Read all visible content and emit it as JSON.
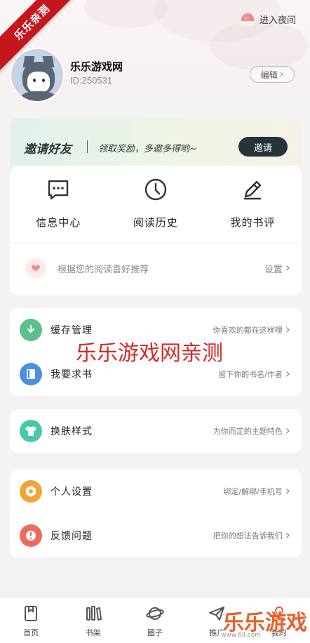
{
  "watermark": {
    "ribbon": "乐乐亲测",
    "center": "乐乐游戏网亲测",
    "bottom": "乐乐游戏",
    "url": "www.6ll.com"
  },
  "header": {
    "night_mode_label": "进入夜间"
  },
  "profile": {
    "name": "乐乐游戏网",
    "id": "ID:250531",
    "edit_label": "编辑"
  },
  "invite": {
    "title": "邀请好友",
    "subtitle": "领取奖励，多邀多得哟~",
    "button_label": "邀请"
  },
  "quick_actions": [
    {
      "label": "信息中心",
      "icon": "message-icon"
    },
    {
      "label": "阅读历史",
      "icon": "clock-icon"
    },
    {
      "label": "我的书评",
      "icon": "pen-icon"
    }
  ],
  "recommend": {
    "text": "根据您的阅读喜好推荐",
    "action": "设置"
  },
  "menu_group_1": [
    {
      "title": "缓存管理",
      "hint": "你喜欢的都在这样哩",
      "icon": "download-icon",
      "color": "#5cc08a"
    },
    {
      "title": "我要求书",
      "hint": "留下你的书名/作者",
      "icon": "book-icon",
      "color": "#4a8fe0"
    }
  ],
  "menu_group_2": [
    {
      "title": "换肤样式",
      "hint": "为你而定的主题特色",
      "icon": "shirt-icon",
      "color": "#46c9a8"
    }
  ],
  "menu_group_3": [
    {
      "title": "个人设置",
      "hint": "绑定/解绑/手机号",
      "icon": "settings-icon",
      "color": "#f0a536"
    },
    {
      "title": "反馈问题",
      "hint": "把你的想法告诉我们",
      "icon": "feedback-icon",
      "color": "#ee6a5a"
    }
  ],
  "tabbar": [
    {
      "label": "首页",
      "icon": "home-icon"
    },
    {
      "label": "书架",
      "icon": "bookshelf-icon"
    },
    {
      "label": "圈子",
      "icon": "planet-icon"
    },
    {
      "label": "推广",
      "icon": "send-icon"
    },
    {
      "label": "我的",
      "icon": "profile-icon"
    }
  ]
}
